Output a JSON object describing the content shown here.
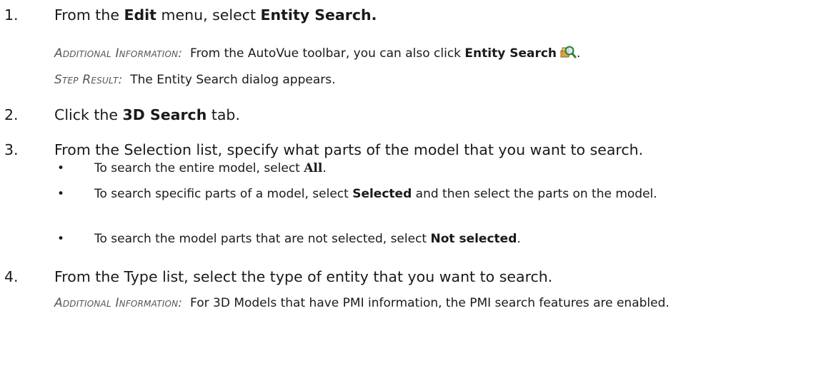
{
  "steps": [
    {
      "number": "1.",
      "pre": "From the ",
      "b1": "Edit",
      "mid": " menu, select ",
      "b2": "Entity Search.",
      "notes": [
        {
          "lead": "Additional Information:",
          "pre": "  From the AutoVue toolbar, you can also click ",
          "bold": "Entity Search",
          "post": ".",
          "icon": "entity-search-icon"
        },
        {
          "lead": "Step Result:",
          "text": "  The Entity Search dialog appears."
        }
      ]
    },
    {
      "number": "2.",
      "pre": "Click the ",
      "bold": "3D Search",
      "post": " tab."
    },
    {
      "number": "3.",
      "text": "From the Selection list, specify what parts of the model that you want to search.",
      "bullets": [
        {
          "marker": "•",
          "pre": "To search the entire model, select ",
          "bold": "All",
          "post": "."
        },
        {
          "marker": "•",
          "pre": "To search specific parts of a model, select ",
          "bold": "Selected",
          "post": " and then select the parts on the model."
        },
        {
          "marker": "•",
          "pre": "To search the model parts that are not selected, select ",
          "bold": "Not selected",
          "post": "."
        }
      ]
    },
    {
      "number": "4.",
      "text": "From the Type list, select the type of entity that you want to search.",
      "note": {
        "lead": "Additional Information:",
        "text": "  For 3D Models that have PMI information, the PMI search features are enabled."
      }
    }
  ]
}
